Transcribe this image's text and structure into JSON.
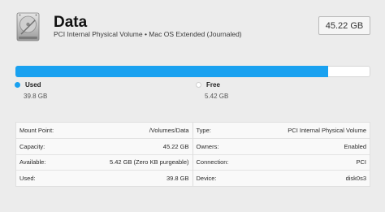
{
  "volume": {
    "name": "Data",
    "description": "PCI Internal Physical Volume • Mac OS Extended (Journaled)",
    "size": "45.22 GB"
  },
  "usage": {
    "used_fraction": 0.88,
    "used_color": "#19a1f0",
    "free_color": "#ffffff",
    "used_label": "Used",
    "used_value": "39.8 GB",
    "free_label": "Free",
    "free_value": "5.42 GB"
  },
  "info": {
    "left": [
      {
        "key": "Mount Point:",
        "value": "/Volumes/Data"
      },
      {
        "key": "Capacity:",
        "value": "45.22 GB"
      },
      {
        "key": "Available:",
        "value": "5.42 GB (Zero KB purgeable)"
      },
      {
        "key": "Used:",
        "value": "39.8 GB"
      }
    ],
    "right": [
      {
        "key": "Type:",
        "value": "PCI Internal Physical Volume"
      },
      {
        "key": "Owners:",
        "value": "Enabled"
      },
      {
        "key": "Connection:",
        "value": "PCI"
      },
      {
        "key": "Device:",
        "value": "disk0s3"
      }
    ]
  },
  "icons": {
    "disk": "hard-disk-icon"
  }
}
